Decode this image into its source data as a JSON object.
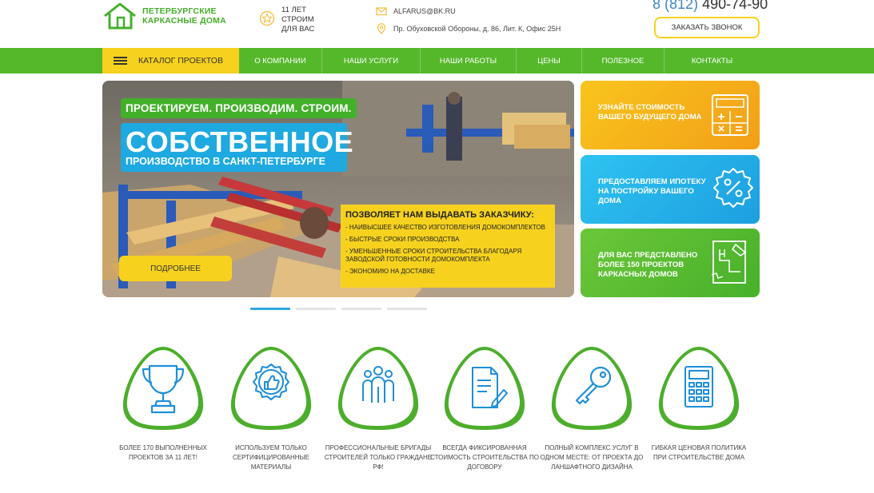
{
  "header": {
    "logo_line1": "ПЕТЕРБУРГСКИЕ",
    "logo_line2": "КАРКАСНЫЕ ДОМА",
    "experience_line1": "11 ЛЕТ",
    "experience_line2": "СТРОИМ",
    "experience_line3": "ДЛЯ ВАС",
    "email": "ALFARUS@BK.RU",
    "address": "Пр. Обуховской Обороны, д. 86, Лит. К, Офис 25Н",
    "phone_code": "8 (812)",
    "phone_number": "490-74-90",
    "callback_label": "ЗАКАЗАТЬ ЗВОНОК"
  },
  "nav": {
    "catalog_label": "КАТАЛОГ ПРОЕКТОВ",
    "items": [
      {
        "label": "О КОМПАНИИ"
      },
      {
        "label": "НАШИ УСЛУГИ"
      },
      {
        "label": "НАШИ РАБОТЫ"
      },
      {
        "label": "ЦЕНЫ"
      },
      {
        "label": "ПОЛЕЗНОЕ"
      },
      {
        "label": "КОНТАКТЫ"
      }
    ]
  },
  "hero": {
    "tagline": "ПРОЕКТИРУЕМ. ПРОИЗВОДИМ. СТРОИМ.",
    "big_title": "СОБСТВЕННОЕ",
    "subtitle": "ПРОИЗВОДСТВО В САНКТ-ПЕТЕРБУРГЕ",
    "box_title": "ПОЗВОЛЯЕТ НАМ ВЫДАВАТЬ ЗАКАЗЧИКУ:",
    "box_items": [
      "- НАИВЫСШЕЕ КАЧЕСТВО ИЗГОТОВЛЕНИЯ ДОМОКОМПЛЕКТОВ",
      "- БЫСТРЫЕ СРОКИ ПРОИЗВОДСТВА",
      "- УМЕНЬШЕННЫЕ СРОКИ СТРОИТЕЛЬСТВА БЛАГОДАРЯ ЗАВОДСКОЙ ГОТОВНОСТИ ДОМОКОМПЛЕКТА",
      "- ЭКОНОМИЮ НА ДОСТАВКЕ"
    ],
    "more_label": "ПОДРОБНЕЕ"
  },
  "side_cards": [
    {
      "text": "УЗНАЙТЕ СТОИМОСТЬ ВАШЕГО БУДУЩЕГО ДОМА",
      "color": "#f6b91b",
      "icon": "calculator-icon"
    },
    {
      "text": "ПРЕДОСТАВЛЯЕМ ИПОТЕКУ НА ПОСТРОЙКУ ВАШЕГО ДОМА",
      "color": "#27b3e8",
      "icon": "percent-badge-icon"
    },
    {
      "text": "ДЛЯ ВАС ПРЕДСТАВЛЕНО БОЛЕЕ 150 ПРОЕКТОВ КАРКАСНЫХ ДОМОВ",
      "color": "#5cbf30",
      "icon": "blueprint-icon"
    }
  ],
  "features": [
    {
      "text": "БОЛЕЕ 170 ВЫПОЛНЕННЫХ ПРОЕКТОВ ЗА 11 ЛЕТ!",
      "icon": "trophy-icon"
    },
    {
      "text": "ИСПОЛЬЗУЕМ ТОЛЬКО СЕРТИФИЦИРОВАННЫЕ МАТЕРИАЛЫ",
      "icon": "thumbs-up-badge-icon"
    },
    {
      "text": "ПРОФЕССИОНАЛЬНЫЕ БРИГАДЫ СТРОИТЕЛЕЙ ТОЛЬКО ГРАЖДАНЕ РФ!",
      "icon": "team-icon"
    },
    {
      "text": "ВСЕГДА ФИКСИРОВАННАЯ СТОИМОСТЬ СТРОИТЕЛЬСТВА ПО ДОГОВОРУ",
      "icon": "contract-icon"
    },
    {
      "text": "ПОЛНЫЙ КОМПЛЕКС УСЛУГ В ОДНОМ МЕСТЕ: ОТ ПРОЕКТА ДО ЛАНШАФТНОГО ДИЗАЙНА",
      "icon": "key-icon"
    },
    {
      "text": "ГИБКАЯ ЦЕНОВАЯ ПОЛИТИКА ПРИ СТРОИТЕЛЬСТВЕ ДОМА",
      "icon": "calculator-icon"
    }
  ],
  "slider": {
    "slides": 4,
    "active": 1
  },
  "colors": {
    "green": "#55b82b",
    "yellow": "#f6d21f",
    "blue": "#2ea7e0",
    "icon_blue": "#1e8fd9"
  }
}
